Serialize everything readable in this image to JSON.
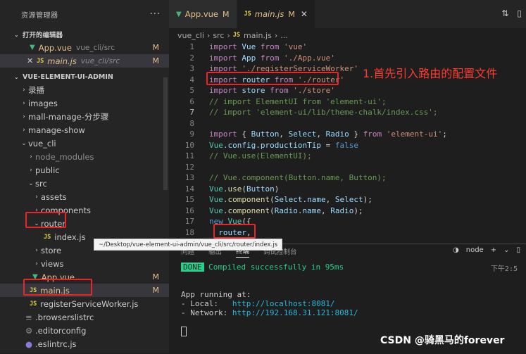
{
  "sidebar": {
    "title": "资源管理器",
    "more": "···",
    "open_editors_label": "打开的编辑器",
    "open_editors": [
      {
        "name": "App.vue",
        "desc": "vue_cli/src",
        "badge": "M"
      },
      {
        "name": "main.js",
        "desc": "vue_cli/src",
        "badge": "M"
      }
    ],
    "project_label": "VUE-ELEMENT-UI-ADMIN",
    "tree": [
      {
        "label": "录播"
      },
      {
        "label": "images"
      },
      {
        "label": "mall-manage-分步骤"
      },
      {
        "label": "manage-show"
      },
      {
        "label": "vue_cli"
      },
      {
        "label": "node_modules"
      },
      {
        "label": "public"
      },
      {
        "label": "src"
      },
      {
        "label": "assets"
      },
      {
        "label": "components"
      },
      {
        "label": "router"
      },
      {
        "label": "index.js"
      },
      {
        "label": "store"
      },
      {
        "label": "views"
      },
      {
        "label": "App.vue",
        "badge": "M"
      },
      {
        "label": "main.js",
        "badge": "M"
      },
      {
        "label": "registerServiceWorker.js"
      },
      {
        "label": ".browserslistrc"
      },
      {
        "label": ".editorconfig"
      },
      {
        "label": ".eslintrc.js"
      }
    ],
    "tooltip": "~/Desktop/vue-element-ui-admin/vue_cli/src/router/index.js"
  },
  "tabs": [
    {
      "label": "App.vue",
      "badge": "M"
    },
    {
      "label": "main.js",
      "badge": "M"
    }
  ],
  "breadcrumb": {
    "a": "vue_cli",
    "b": "src",
    "c": "main.js",
    "d": "..."
  },
  "code_lines": [
    "1",
    "2",
    "3",
    "4",
    "5",
    "6",
    "7",
    "8",
    "9",
    "10",
    "11",
    "12",
    "13",
    "14",
    "15",
    "16",
    "17",
    "18"
  ],
  "code": {
    "l1": {
      "a": "import",
      "b": "Vue",
      "c": "from",
      "d": "'vue'"
    },
    "l2": {
      "a": "import",
      "b": "App",
      "c": "from",
      "d": "'./App.vue'"
    },
    "l3": {
      "a": "import",
      "d": "'./registerServiceWorker'"
    },
    "l4": {
      "a": "import",
      "b": "router",
      "c": "from",
      "d": "'./router'"
    },
    "l5": {
      "a": "import",
      "b": "store",
      "c": "from",
      "d": "'./store'"
    },
    "l6": "// import ElementUI from 'element-ui';",
    "l7": "// import 'element-ui/lib/theme-chalk/index.css';",
    "l9": {
      "a": "import",
      "b": "{ ",
      "c": "Button",
      "d": ", ",
      "e": "Select",
      "f": ", ",
      "g": "Radio",
      "h": " }",
      "i": "from",
      "j": "'element-ui'",
      "k": ";"
    },
    "l10": {
      "a": "Vue",
      "b": ".",
      "c": "config",
      "d": ".",
      "e": "productionTip",
      "f": " = ",
      "g": "false"
    },
    "l11": "// Vue.use(ElementUI);",
    "l13": "// Vue.component(Button.name, Button);",
    "l14": {
      "a": "Vue",
      "b": ".",
      "c": "use",
      "d": "(",
      "e": "Button",
      "f": ")"
    },
    "l15": {
      "a": "Vue",
      "b": ".",
      "c": "component",
      "d": "(",
      "e": "Select",
      "f": ".",
      "g": "name",
      "h": ", ",
      "i": "Select",
      "j": ");"
    },
    "l16": {
      "a": "Vue",
      "b": ".",
      "c": "component",
      "d": "(",
      "e": "Radio",
      "f": ".",
      "g": "name",
      "h": ", ",
      "i": "Radio",
      "j": ");"
    },
    "l17": {
      "a": "new",
      "b": "Vue",
      "c": "({"
    },
    "l18": {
      "a": "router",
      "b": ","
    }
  },
  "annotation": "1.首先引入路由的配置文件",
  "panel": {
    "tabs": [
      "问题",
      "输出",
      "终端",
      "调试控制台"
    ],
    "shell": "node",
    "done_badge": "DONE",
    "compiled": "Compiled successfully in 95ms",
    "time": "下午2:5",
    "running": "App running at:",
    "local_label": "- Local:   ",
    "local_url": "http://localhost:8081/",
    "network_label": "- Network: ",
    "network_url": "http://192.168.31.121:8081/"
  },
  "watermark": "CSDN @骑黑马的forever"
}
